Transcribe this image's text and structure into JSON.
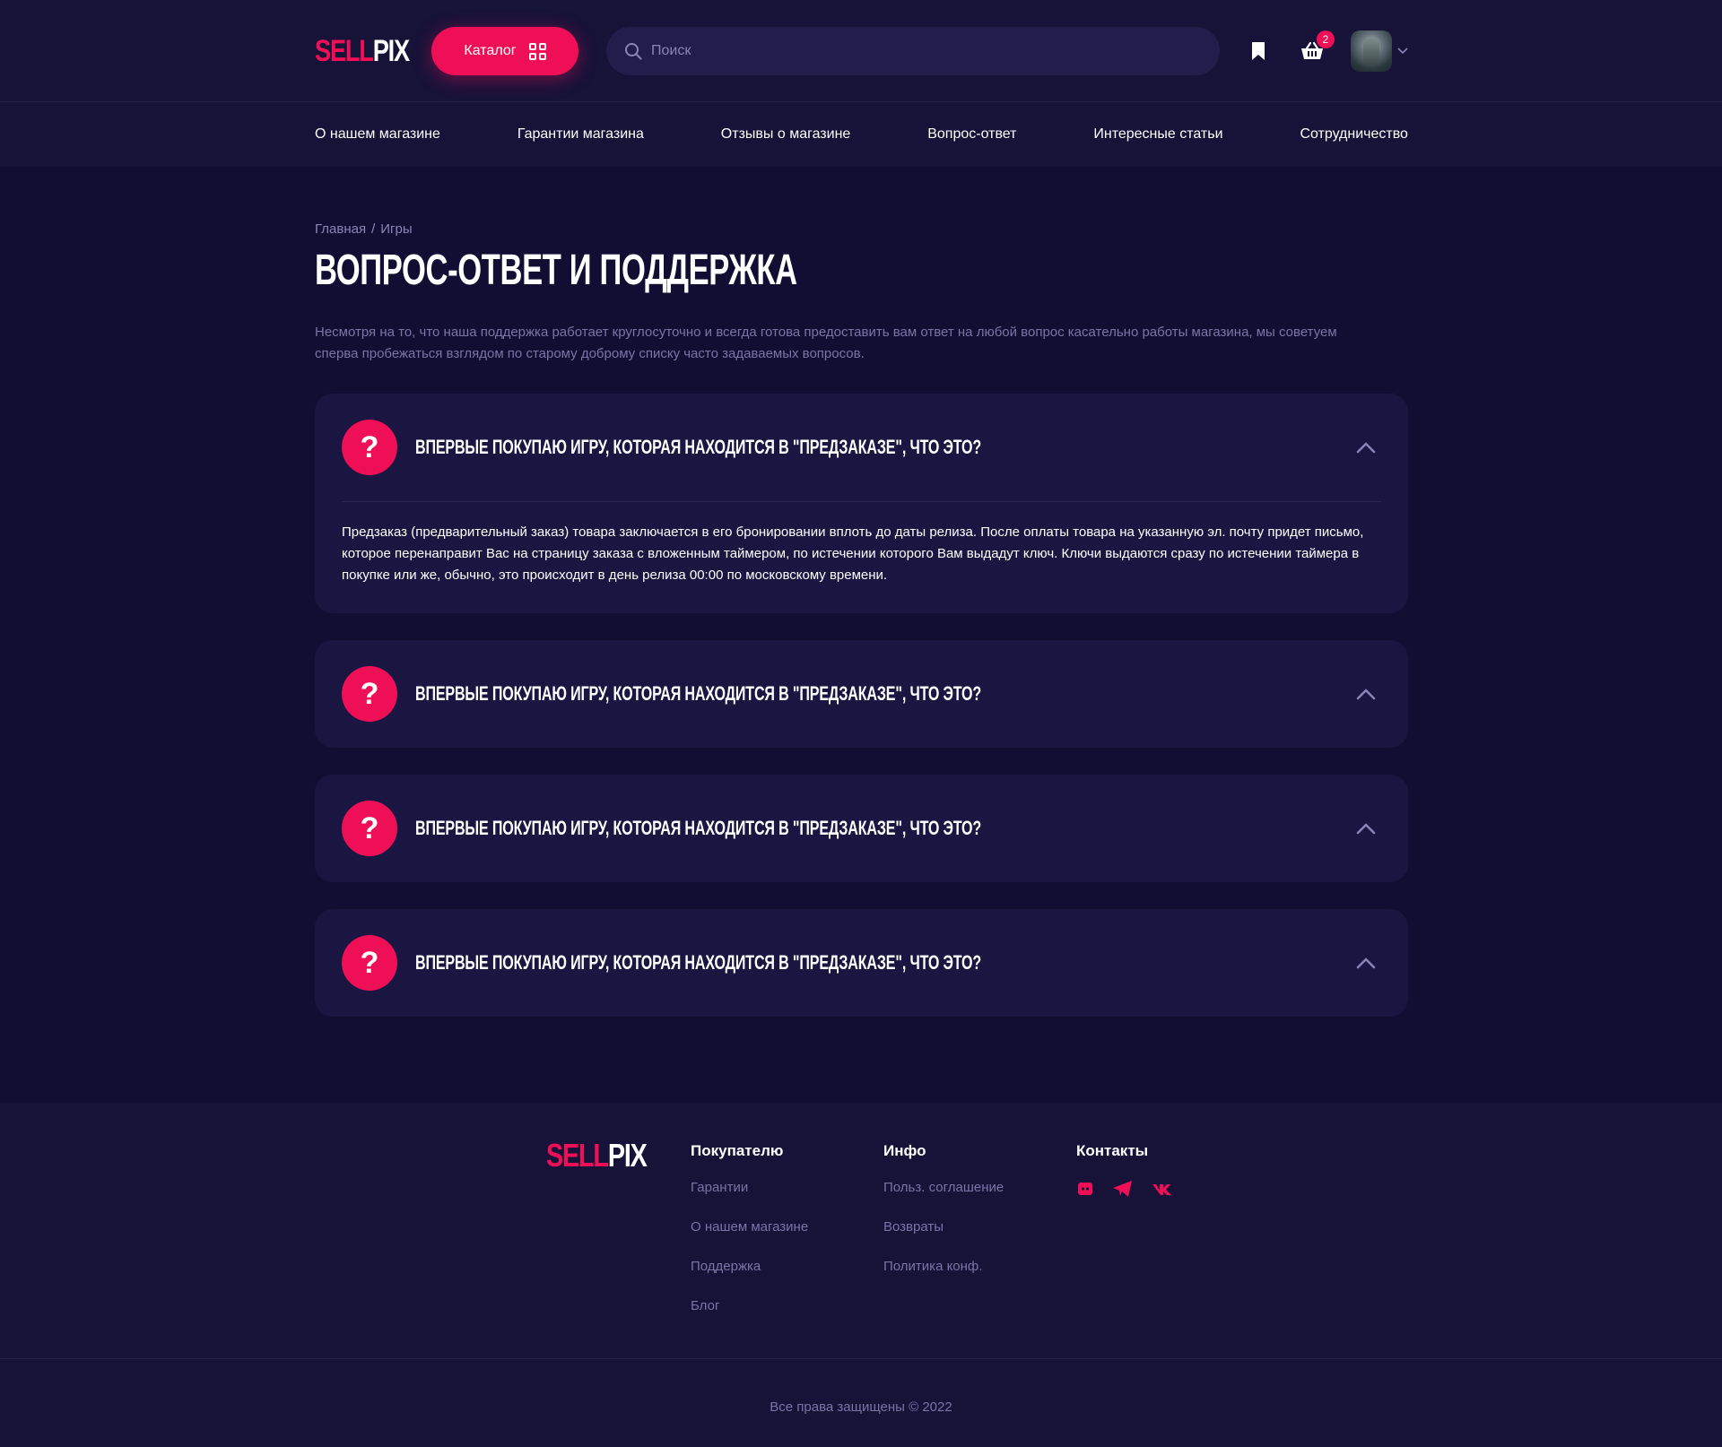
{
  "brand": {
    "part1": "SELL",
    "part2": "PIX"
  },
  "header": {
    "catalog_label": "Каталог",
    "search_placeholder": "Поиск",
    "cart_count": "2",
    "colors": {
      "accent": "#ee0f56",
      "bg": "#120e33",
      "panel": "#1a1541"
    }
  },
  "nav": {
    "items": [
      {
        "label": "О нашем магазине"
      },
      {
        "label": "Гарантии магазина"
      },
      {
        "label": "Отзывы о магазине"
      },
      {
        "label": "Вопрос-ответ"
      },
      {
        "label": "Интересные статьи"
      },
      {
        "label": "Сотрудничество"
      }
    ]
  },
  "breadcrumb": {
    "home": "Главная",
    "separator": "/",
    "current": "Игры"
  },
  "page": {
    "title": "ВОПРОС-ОТВЕТ И ПОДДЕРЖКА",
    "intro": "Несмотря на то, что наша поддержка работает круглосуточно и всегда готова предоставить вам ответ на любой вопрос касательно работы магазина, мы советуем сперва пробежаться взглядом по старому доброму списку часто задаваемых вопросов."
  },
  "faq": [
    {
      "icon": "?",
      "question": "ВПЕРВЫЕ ПОКУПАЮ ИГРУ, КОТОРАЯ НАХОДИТСЯ В \"ПРЕДЗАКАЗЕ\", ЧТО ЭТО?",
      "answer": "Предзаказ (предварительный заказ) товара заключается в его бронировании вплоть до даты релиза. После оплаты товара на указанную эл. почту придет письмо, которое перенаправит Вас на страницу заказа с вложенным таймером, по истечении которого Вам выдадут ключ. Ключи выдаются сразу по истечении таймера в покупке или же, обычно, это происходит в день релиза 00:00 по московскому времени."
    },
    {
      "icon": "?",
      "question": "ВПЕРВЫЕ ПОКУПАЮ ИГРУ, КОТОРАЯ НАХОДИТСЯ В \"ПРЕДЗАКАЗЕ\", ЧТО ЭТО?"
    },
    {
      "icon": "?",
      "question": "ВПЕРВЫЕ ПОКУПАЮ ИГРУ, КОТОРАЯ НАХОДИТСЯ В \"ПРЕДЗАКАЗЕ\", ЧТО ЭТО?"
    },
    {
      "icon": "?",
      "question": "ВПЕРВЫЕ ПОКУПАЮ ИГРУ, КОТОРАЯ НАХОДИТСЯ В \"ПРЕДЗАКАЗЕ\", ЧТО ЭТО?"
    }
  ],
  "footer": {
    "buyer": {
      "title": "Покупателю",
      "links": [
        "Гарантии",
        "О нашем магазине",
        "Поддержка",
        "Блог"
      ]
    },
    "info": {
      "title": "Инфо",
      "links": [
        "Польз. соглашение",
        "Возвраты",
        "Политика конф."
      ]
    },
    "contacts": {
      "title": "Контакты",
      "icons": [
        "discord-icon",
        "telegram-icon",
        "vk-icon"
      ]
    },
    "copyright": "Все права защищены © 2022"
  }
}
